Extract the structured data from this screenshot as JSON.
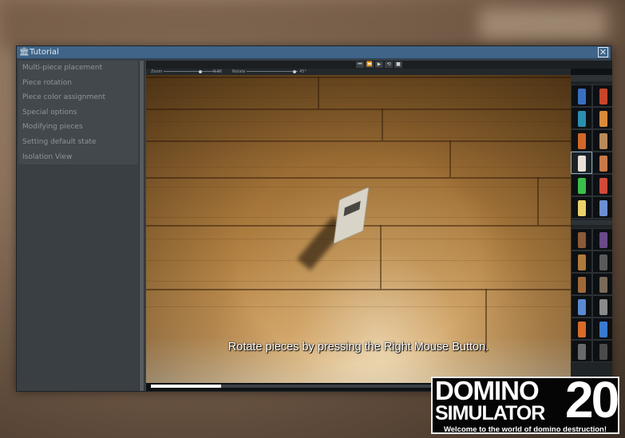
{
  "window": {
    "title": "Tutorial",
    "title_icon": "building-icon",
    "close_icon": "close-icon"
  },
  "sidebar": {
    "items": [
      {
        "label": "Multi-piece placement"
      },
      {
        "label": "Piece rotation"
      },
      {
        "label": "Piece color assignment"
      },
      {
        "label": "Special options"
      },
      {
        "label": "Modifying pieces"
      },
      {
        "label": "Setting default state"
      },
      {
        "label": "Isolation View"
      }
    ]
  },
  "video": {
    "toolbar_icons": [
      "skip-back-icon",
      "step-back-icon",
      "play-icon",
      "loop-icon",
      "stop-icon"
    ],
    "controls": {
      "zoom_label": "Zoom",
      "zoom_value": "0.36",
      "rotate_label": "Rotate",
      "rotate_value": "45°"
    },
    "subtitle": "Rotate pieces by pressing the Right Mouse Button.",
    "progress": 0.17
  },
  "logo": {
    "line1": "DOMINO",
    "line2": "SIMULATOR",
    "number": "20",
    "tagline": "Welcome to the world of domino destruction!"
  },
  "colors": {
    "titlebar": "#3f6487",
    "window_bg": "#3a3f44",
    "sidebar_text": "#8e959b",
    "selected_border": "#8aa8c4"
  }
}
